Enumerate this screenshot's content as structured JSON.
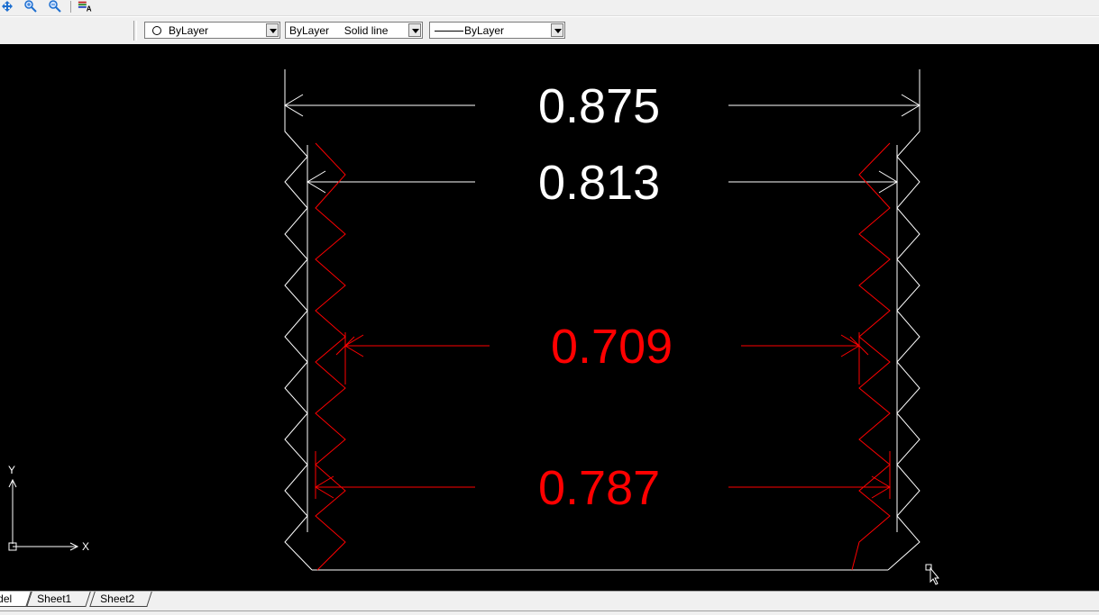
{
  "toolbar": {
    "icons": [
      "pan-icon",
      "zoom-realtime-icon",
      "zoom-previous-icon",
      "text-style-icon"
    ]
  },
  "properties": {
    "color_value": "ByLayer",
    "linetype_value": "ByLayer     Solid line",
    "lineweight_value": "ByLayer"
  },
  "dimensions": {
    "d1": "0.875",
    "d2": "0.813",
    "d3": "0.709",
    "d4": "0.787"
  },
  "ucs": {
    "x_label": "X",
    "y_label": "Y"
  },
  "tabs": [
    {
      "label": "del"
    },
    {
      "label": "Sheet1"
    },
    {
      "label": "Sheet2"
    }
  ],
  "colors": {
    "canvas": "#000000",
    "white_geometry": "#ffffff",
    "red_geometry": "#ff0000"
  }
}
